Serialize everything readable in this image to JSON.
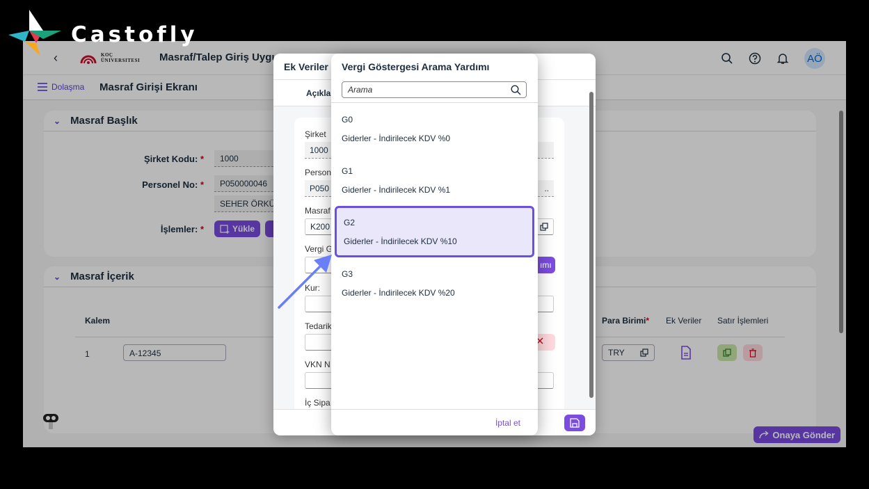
{
  "brand": {
    "name": "Castofly"
  },
  "shell": {
    "university": [
      "KOÇ",
      "ÜNIVERSITESI"
    ],
    "app_title": "Masraf/Talep Giriş Uygu",
    "avatar_initials": "AÖ"
  },
  "subbar": {
    "nav_label": "Dolaşma",
    "title": "Masraf Girişi Ekranı"
  },
  "header_panel": {
    "title": "Masraf Başlık",
    "company_label": "Şirket Kodu:",
    "company_value": "1000",
    "personnel_label": "Personel No:",
    "personnel_value": "P050000046",
    "personnel_name": "SEHER ÖRKÜ",
    "actions_label": "İşlemler:",
    "upload_label": "Yükle",
    "required_mark": "*"
  },
  "content_panel": {
    "title": "Masraf İçerik",
    "columns": {
      "item": "Kalem",
      "currency": "Para Birimi",
      "extra": "Ek Veriler",
      "row_actions": "Satır İşlemleri"
    },
    "row": {
      "index": "1",
      "value": "A-12345",
      "currency": "TRY"
    }
  },
  "footer": {
    "submit_label": "Onaya Gönder"
  },
  "ek_veriler_dialog": {
    "title": "Ek Veriler",
    "tab": "Açıkla",
    "labels": [
      "Şirket",
      "Person",
      "Masraf",
      "Vergi G",
      "Kur:",
      "Tedarik",
      "VKN N",
      "İç Sipa"
    ],
    "values": {
      "company": "1000",
      "personnel": "P050",
      "expense": "K200"
    },
    "partial_button": "ımı",
    "ellipsis": ".."
  },
  "value_help": {
    "title": "Vergi Göstergesi Arama Yardımı",
    "search_placeholder": "Arama",
    "items": [
      {
        "code": "G0",
        "desc": "Giderler - İndirilecek KDV %0"
      },
      {
        "code": "G1",
        "desc": "Giderler - İndirilecek KDV %1"
      },
      {
        "code": "G2",
        "desc": "Giderler - İndirilecek KDV %10"
      },
      {
        "code": "G3",
        "desc": "Giderler - İndirilecek KDV %20"
      }
    ],
    "selected_code": "G2",
    "cancel_label": "İptal et"
  },
  "colors": {
    "accent": "#7b4ce0",
    "highlight": "#6a4fe0",
    "danger": "#d0021b"
  }
}
